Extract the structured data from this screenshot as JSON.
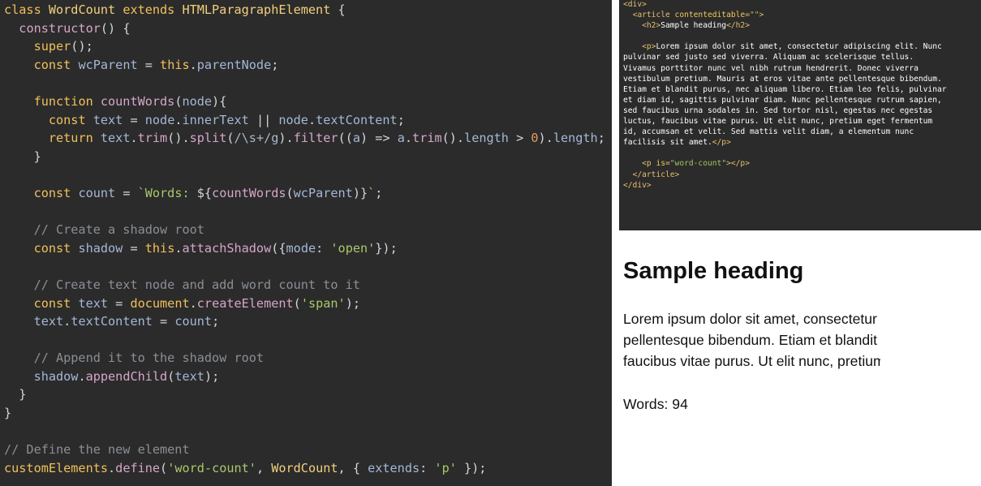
{
  "editor": {
    "lines": [
      [
        [
          "kw",
          "class "
        ],
        [
          "cls",
          "WordCount "
        ],
        [
          "kw",
          "extends "
        ],
        [
          "cls",
          "HTMLParagraphElement "
        ],
        [
          "pl",
          "{"
        ]
      ],
      [
        [
          "pl",
          "  "
        ],
        [
          "fn",
          "constructor"
        ],
        [
          "pl",
          "() {"
        ]
      ],
      [
        [
          "pl",
          "    "
        ],
        [
          "kw",
          "super"
        ],
        [
          "pl",
          "();"
        ]
      ],
      [
        [
          "pl",
          "    "
        ],
        [
          "kw",
          "const "
        ],
        [
          "prop",
          "wcParent"
        ],
        [
          "pl",
          " = "
        ],
        [
          "kw",
          "this"
        ],
        [
          "pl",
          "."
        ],
        [
          "prop",
          "parentNode"
        ],
        [
          "pl",
          ";"
        ]
      ],
      [
        [
          "pl",
          ""
        ]
      ],
      [
        [
          "pl",
          "    "
        ],
        [
          "kw",
          "function "
        ],
        [
          "fn",
          "countWords"
        ],
        [
          "pl",
          "("
        ],
        [
          "prop",
          "node"
        ],
        [
          "pl",
          "){"
        ]
      ],
      [
        [
          "pl",
          "      "
        ],
        [
          "kw",
          "const "
        ],
        [
          "prop",
          "text"
        ],
        [
          "pl",
          " = "
        ],
        [
          "prop",
          "node"
        ],
        [
          "pl",
          "."
        ],
        [
          "prop",
          "innerText"
        ],
        [
          "pl",
          " || "
        ],
        [
          "prop",
          "node"
        ],
        [
          "pl",
          "."
        ],
        [
          "prop",
          "textContent"
        ],
        [
          "pl",
          ";"
        ]
      ],
      [
        [
          "pl",
          "      "
        ],
        [
          "kw",
          "return "
        ],
        [
          "prop",
          "text"
        ],
        [
          "pl",
          "."
        ],
        [
          "fn",
          "trim"
        ],
        [
          "pl",
          "()."
        ],
        [
          "fn",
          "split"
        ],
        [
          "pl",
          "("
        ],
        [
          "rx",
          "/\\s+/g"
        ],
        [
          "pl",
          ")."
        ],
        [
          "fn",
          "filter"
        ],
        [
          "pl",
          "(("
        ],
        [
          "prop",
          "a"
        ],
        [
          "pl",
          ") => "
        ],
        [
          "prop",
          "a"
        ],
        [
          "pl",
          "."
        ],
        [
          "fn",
          "trim"
        ],
        [
          "pl",
          "()."
        ],
        [
          "prop",
          "length"
        ],
        [
          "pl",
          " > "
        ],
        [
          "num",
          "0"
        ],
        [
          "pl",
          ")."
        ],
        [
          "prop",
          "length"
        ],
        [
          "pl",
          ";"
        ]
      ],
      [
        [
          "pl",
          "    }"
        ]
      ],
      [
        [
          "pl",
          ""
        ]
      ],
      [
        [
          "pl",
          "    "
        ],
        [
          "kw",
          "const "
        ],
        [
          "prop",
          "count"
        ],
        [
          "pl",
          " = "
        ],
        [
          "str",
          "`Words: "
        ],
        [
          "pl",
          "${"
        ],
        [
          "fn",
          "countWords"
        ],
        [
          "pl",
          "("
        ],
        [
          "prop",
          "wcParent"
        ],
        [
          "pl",
          ")}"
        ],
        [
          "str",
          "`"
        ],
        [
          "pl",
          ";"
        ]
      ],
      [
        [
          "pl",
          ""
        ]
      ],
      [
        [
          "com",
          "    // Create a shadow root"
        ]
      ],
      [
        [
          "pl",
          "    "
        ],
        [
          "kw",
          "const "
        ],
        [
          "prop",
          "shadow"
        ],
        [
          "pl",
          " = "
        ],
        [
          "kw",
          "this"
        ],
        [
          "pl",
          "."
        ],
        [
          "fn",
          "attachShadow"
        ],
        [
          "pl",
          "({"
        ],
        [
          "prop",
          "mode"
        ],
        [
          "pl",
          ": "
        ],
        [
          "str",
          "'open'"
        ],
        [
          "pl",
          "});"
        ]
      ],
      [
        [
          "pl",
          ""
        ]
      ],
      [
        [
          "com",
          "    // Create text node and add word count to it"
        ]
      ],
      [
        [
          "pl",
          "    "
        ],
        [
          "kw",
          "const "
        ],
        [
          "prop",
          "text"
        ],
        [
          "pl",
          " = "
        ],
        [
          "kw",
          "document"
        ],
        [
          "pl",
          "."
        ],
        [
          "fn",
          "createElement"
        ],
        [
          "pl",
          "("
        ],
        [
          "str",
          "'span'"
        ],
        [
          "pl",
          ");"
        ]
      ],
      [
        [
          "pl",
          "    "
        ],
        [
          "prop",
          "text"
        ],
        [
          "pl",
          "."
        ],
        [
          "prop",
          "textContent"
        ],
        [
          "pl",
          " = "
        ],
        [
          "prop",
          "count"
        ],
        [
          "pl",
          ";"
        ]
      ],
      [
        [
          "pl",
          ""
        ]
      ],
      [
        [
          "com",
          "    // Append it to the shadow root"
        ]
      ],
      [
        [
          "pl",
          "    "
        ],
        [
          "prop",
          "shadow"
        ],
        [
          "pl",
          "."
        ],
        [
          "fn",
          "appendChild"
        ],
        [
          "pl",
          "("
        ],
        [
          "prop",
          "text"
        ],
        [
          "pl",
          ");"
        ]
      ],
      [
        [
          "pl",
          "  }"
        ]
      ],
      [
        [
          "pl",
          "}"
        ]
      ],
      [
        [
          "pl",
          ""
        ]
      ],
      [
        [
          "com",
          "// Define the new element"
        ]
      ],
      [
        [
          "kw",
          "customElements"
        ],
        [
          "pl",
          "."
        ],
        [
          "fn",
          "define"
        ],
        [
          "pl",
          "("
        ],
        [
          "str",
          "'word-count'"
        ],
        [
          "pl",
          ", "
        ],
        [
          "cls",
          "WordCount"
        ],
        [
          "pl",
          ", { "
        ],
        [
          "prop",
          "extends"
        ],
        [
          "pl",
          ": "
        ],
        [
          "str",
          "'p'"
        ],
        [
          "pl",
          " });"
        ]
      ]
    ]
  },
  "html_source": {
    "lines": [
      [
        [
          "tag",
          "<div>"
        ]
      ],
      [
        [
          "txt",
          "  "
        ],
        [
          "tag",
          "<article "
        ],
        [
          "attr",
          "contenteditable"
        ],
        [
          "tag",
          "="
        ],
        [
          "aval",
          "\"\""
        ],
        [
          "tag",
          ">"
        ]
      ],
      [
        [
          "txt",
          "    "
        ],
        [
          "tag",
          "<h2>"
        ],
        [
          "txt",
          "Sample heading"
        ],
        [
          "tag",
          "</h2>"
        ]
      ],
      [
        [
          "txt",
          ""
        ]
      ],
      [
        [
          "txt",
          "    "
        ],
        [
          "tag",
          "<p>"
        ],
        [
          "txt",
          "Lorem ipsum dolor sit amet, consectetur adipiscing elit. Nunc"
        ]
      ],
      [
        [
          "txt",
          "pulvinar sed justo sed viverra. Aliquam ac scelerisque tellus."
        ]
      ],
      [
        [
          "txt",
          "Vivamus porttitor nunc vel nibh rutrum hendrerit. Donec viverra"
        ]
      ],
      [
        [
          "txt",
          "vestibulum pretium. Mauris at eros vitae ante pellentesque bibendum."
        ]
      ],
      [
        [
          "txt",
          "Etiam et blandit purus, nec aliquam libero. Etiam leo felis, pulvinar"
        ]
      ],
      [
        [
          "txt",
          "et diam id, sagittis pulvinar diam. Nunc pellentesque rutrum sapien,"
        ]
      ],
      [
        [
          "txt",
          "sed faucibus urna sodales in. Sed tortor nisl, egestas nec egestas"
        ]
      ],
      [
        [
          "txt",
          "luctus, faucibus vitae purus. Ut elit nunc, pretium eget fermentum"
        ]
      ],
      [
        [
          "txt",
          "id, accumsan et velit. Sed mattis velit diam, a elementum nunc"
        ]
      ],
      [
        [
          "txt",
          "facilisis sit amet."
        ],
        [
          "tag",
          "</p>"
        ]
      ],
      [
        [
          "txt",
          ""
        ]
      ],
      [
        [
          "txt",
          "    "
        ],
        [
          "tag",
          "<p "
        ],
        [
          "attr",
          "is"
        ],
        [
          "tag",
          "="
        ],
        [
          "aval",
          "\"word-count\""
        ],
        [
          "tag",
          "></p>"
        ]
      ],
      [
        [
          "txt",
          "  "
        ],
        [
          "tag",
          "</article>"
        ]
      ],
      [
        [
          "tag",
          "</div>"
        ]
      ]
    ]
  },
  "preview": {
    "heading": "Sample heading",
    "paragraph_lines": [
      "Lorem ipsum dolor sit amet, consectetur",
      "pellentesque bibendum. Etiam et blandit",
      "faucibus vitae purus. Ut elit nunc, pretium"
    ],
    "word_count": "Words: 94"
  }
}
